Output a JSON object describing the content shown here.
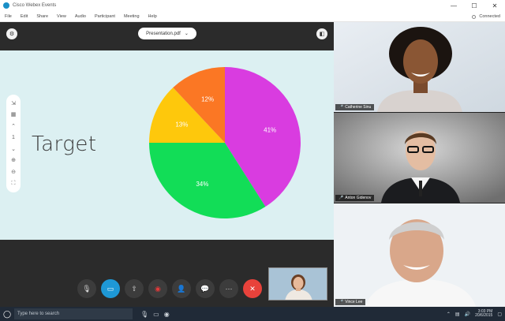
{
  "window": {
    "title": "Cisco Webex Events",
    "controls": {
      "minimize": "—",
      "maximize": "☐",
      "close": "✕"
    },
    "connection_status": "Connected"
  },
  "menu": [
    "File",
    "Edit",
    "Share",
    "View",
    "Audio",
    "Participant",
    "Meeting",
    "Help"
  ],
  "stage": {
    "file_name": "Presentation.pdf",
    "slide_title": "Target"
  },
  "chart_data": {
    "type": "pie",
    "slices": [
      {
        "label": "41%",
        "value": 41,
        "color": "#d93ce0"
      },
      {
        "label": "34%",
        "value": 34,
        "color": "#12dd57"
      },
      {
        "label": "13%",
        "value": 13,
        "color": "#fec80c"
      },
      {
        "label": "12%",
        "value": 12,
        "color": "#fb7724"
      }
    ]
  },
  "zoom_tools": [
    "⇲",
    "▦",
    "⌃",
    "1",
    "⌄",
    "⊕",
    "⊖",
    "⛶"
  ],
  "controls": [
    {
      "id": "mute",
      "icon": "mic-off-icon",
      "glyph": "🎙"
    },
    {
      "id": "video",
      "icon": "video-icon",
      "glyph": "▭"
    },
    {
      "id": "share",
      "icon": "share-icon",
      "glyph": "⇧"
    },
    {
      "id": "record",
      "icon": "record-icon",
      "glyph": "◉"
    },
    {
      "id": "participants",
      "icon": "participants-icon",
      "glyph": "👤"
    },
    {
      "id": "chat",
      "icon": "chat-icon",
      "glyph": "💬"
    },
    {
      "id": "more",
      "icon": "more-icon",
      "glyph": "⋯"
    },
    {
      "id": "end",
      "icon": "end-call-icon",
      "glyph": "✕"
    }
  ],
  "participants": [
    {
      "name": "Catherine Sinu"
    },
    {
      "name": "Anton Gidenov"
    },
    {
      "name": "Vince Lee"
    }
  ],
  "taskbar": {
    "search_placeholder": "Type here to search",
    "time": "3:03 PM",
    "date": "20/6/2015"
  }
}
